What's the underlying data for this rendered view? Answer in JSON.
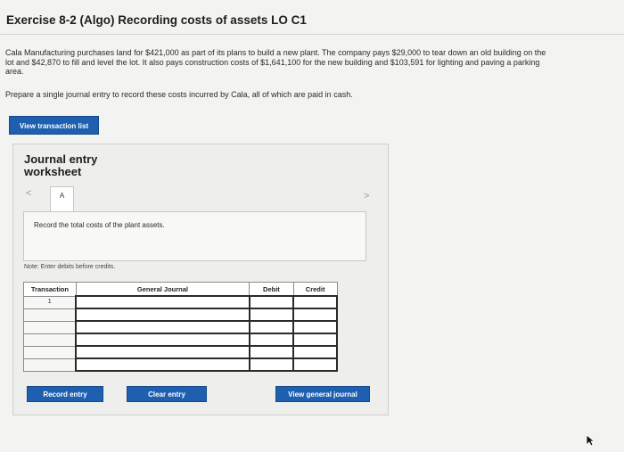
{
  "header": {
    "title": "Exercise 8-2 (Algo) Recording costs of assets LO C1"
  },
  "problem": {
    "text": "Cala Manufacturing purchases land for $421,000 as part of its plans to build a new plant. The company pays $29,000 to tear down an old building on the lot and $42,870 to fill and level the lot. It also pays construction costs of $1,641,100 for the new building and $103,591 for lighting and paving a parking area.",
    "prompt": "Prepare a single journal entry to record these costs incurred by Cala, all of which are paid in cash."
  },
  "view_transaction_list_label": "View transaction list",
  "worksheet": {
    "title": "Journal entry worksheet",
    "prev_glyph": "<",
    "next_glyph": ">",
    "tab_label": "A",
    "instruction": "Record the total costs of the plant assets.",
    "note": "Note: Enter debits before credits.",
    "columns": {
      "transaction": "Transaction",
      "general_journal": "General Journal",
      "debit": "Debit",
      "credit": "Credit"
    },
    "rows": [
      {
        "transaction": "1"
      },
      {
        "transaction": ""
      },
      {
        "transaction": ""
      },
      {
        "transaction": ""
      },
      {
        "transaction": ""
      },
      {
        "transaction": ""
      }
    ],
    "buttons": {
      "record": "Record entry",
      "clear": "Clear entry",
      "view_journal": "View general journal"
    }
  },
  "colors": {
    "button_blue": "#1f5fb0",
    "background": "#f3f3f1"
  }
}
